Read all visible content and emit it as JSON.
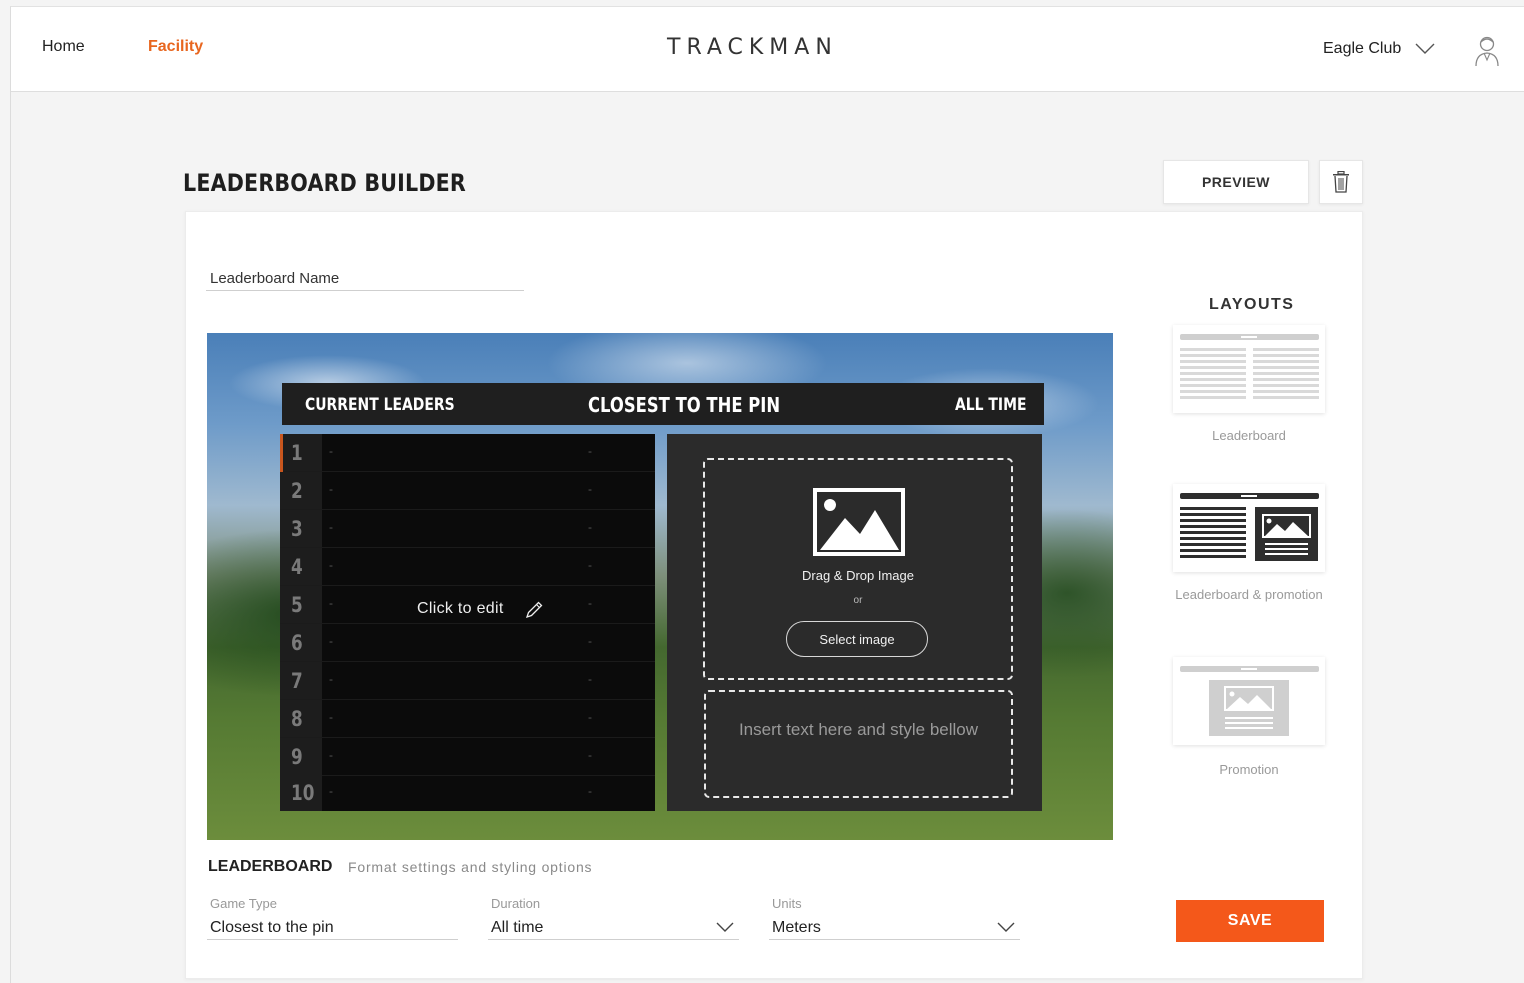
{
  "nav": {
    "home": "Home",
    "facility": "Facility",
    "brand": "TRACKMAN",
    "club": "Eagle Club",
    "active_color": "#e8661f"
  },
  "page": {
    "title": "LEADERBOARD BUILDER",
    "preview_label": "PREVIEW"
  },
  "form": {
    "name_label": "Leaderboard Name"
  },
  "board": {
    "header_left": "CURRENT LEADERS",
    "header_mid": "CLOSEST TO THE PIN",
    "header_right": "ALL TIME",
    "ranks": [
      "1",
      "2",
      "3",
      "4",
      "5",
      "6",
      "7",
      "8",
      "9",
      "10"
    ],
    "player_placeholder": "-",
    "score_placeholder": "-",
    "click_to_edit": "Click to edit"
  },
  "promo": {
    "drop_text": "Drag & Drop Image",
    "or_text": "or",
    "select_label": "Select image",
    "text_placeholder": "Insert text here and style bellow"
  },
  "layouts": {
    "title": "LAYOUTS",
    "items": [
      {
        "label": "Leaderboard"
      },
      {
        "label": "Leaderboard & promotion"
      },
      {
        "label": "Promotion"
      }
    ]
  },
  "settings": {
    "section_title": "LEADERBOARD",
    "section_subtitle": "Format settings and styling options",
    "game_type_label": "Game Type",
    "game_type_value": "Closest to the pin",
    "duration_label": "Duration",
    "duration_value": "All time",
    "units_label": "Units",
    "units_value": "Meters",
    "save_label": "SAVE",
    "save_color": "#f4581a"
  }
}
